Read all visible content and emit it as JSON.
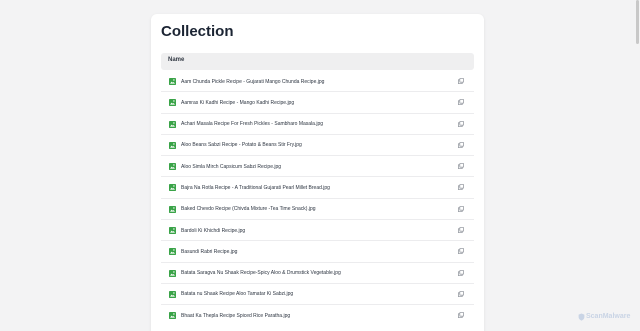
{
  "title": "Collection",
  "table": {
    "header": "Name",
    "rows": [
      {
        "name": "Aam Chunda Pickle Recipe - Gujarati Mango Chunda Recipe.jpg",
        "icon": "image-icon",
        "action_icon": "copy-icon"
      },
      {
        "name": "Aamras Ki Kadhi Recipe - Mango Kadhi Recipe.jpg",
        "icon": "image-icon",
        "action_icon": "copy-icon"
      },
      {
        "name": "Achari Masala Recipe For Fresh Pickles - Sambharo Masala.jpg",
        "icon": "image-icon",
        "action_icon": "copy-icon"
      },
      {
        "name": "Aloo Beans Sabzi Recipe - Potato & Beans Stir Fry.jpg",
        "icon": "image-icon",
        "action_icon": "copy-icon"
      },
      {
        "name": "Aloo Simla Mirch Capsicum Sabzi Recipe.jpg",
        "icon": "image-icon",
        "action_icon": "copy-icon"
      },
      {
        "name": "Bajra Na Rotla Recipe - A Traditional Gujarati Pearl Millet Bread.jpg",
        "icon": "image-icon",
        "action_icon": "copy-icon"
      },
      {
        "name": "Baked Chevdo Recipe (Chivda Mixture -Tea Time Snack).jpg",
        "icon": "image-icon",
        "action_icon": "copy-icon"
      },
      {
        "name": "Bardoli Ki Khichdi Recipe.jpg",
        "icon": "image-icon",
        "action_icon": "copy-icon"
      },
      {
        "name": "Basundi Rabri Recipe.jpg",
        "icon": "image-icon",
        "action_icon": "copy-icon"
      },
      {
        "name": "Batata Saragva Nu Shaak Recipe-Spicy Aloo & Drumstick Vegetable.jpg",
        "icon": "image-icon",
        "action_icon": "copy-icon"
      },
      {
        "name": "Batata nu Shaak Recipe Aloo Tamatar Ki Sabzi.jpg",
        "icon": "image-icon",
        "action_icon": "copy-icon"
      },
      {
        "name": "Bhaat Ka Thepla Recipe Spiced Rice Paratha.jpg",
        "icon": "image-icon",
        "action_icon": "copy-icon"
      }
    ]
  },
  "watermark": {
    "text": "ScanMalware",
    "icon": "shield-icon"
  },
  "colors": {
    "background": "#f3f3f4",
    "card": "#ffffff",
    "header_bg": "#efeff0",
    "image_icon": "#3aa348",
    "copy_icon": "#9a9ea5"
  }
}
